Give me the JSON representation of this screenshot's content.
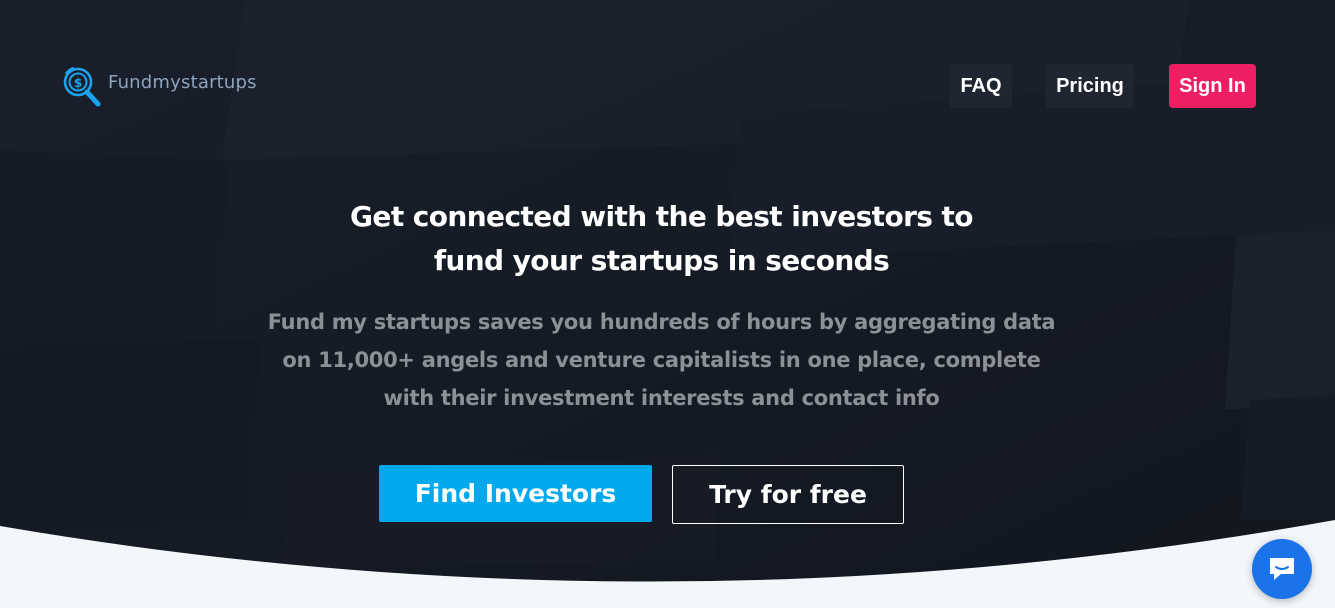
{
  "brand": {
    "name": "Fundmystartups",
    "logo_icon": "dollar-search-icon",
    "accent": "#03a9ed"
  },
  "nav": {
    "faq_label": "FAQ",
    "pricing_label": "Pricing",
    "signin_label": "Sign In",
    "signin_color": "#eb1f62"
  },
  "hero": {
    "headline_line1": "Get connected with the best investors to",
    "headline_line2": "fund your startups in seconds",
    "subtext_line1": "Fund my startups saves you hundreds of hours by aggregating data",
    "subtext_line2": "on 11,000+ angels and venture capitalists in one place, complete",
    "subtext_line3": "with their investment interests and contact info",
    "background_color": "#141a24",
    "find_investors_label": "Find Investors",
    "try_free_label": "Try for free"
  },
  "chat": {
    "icon": "chat-bubble-icon",
    "color": "#1a73e8"
  }
}
